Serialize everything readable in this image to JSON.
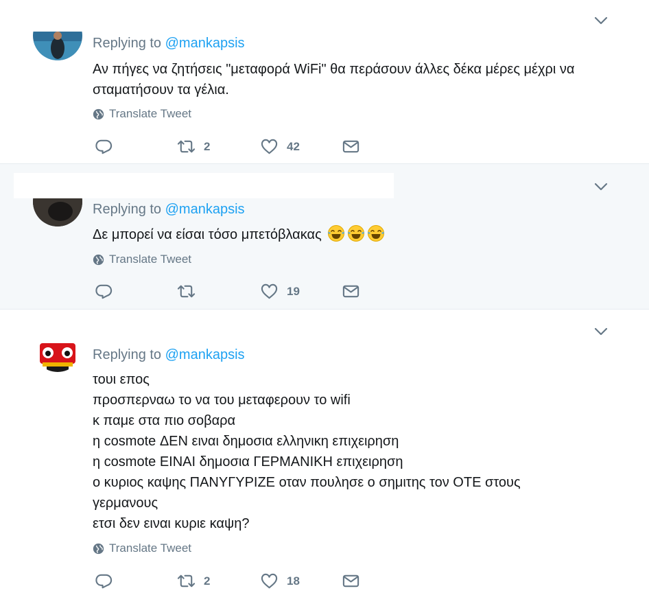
{
  "colors": {
    "accent": "#1da1f2",
    "muted": "#657786",
    "text": "#14171a",
    "highlight_bg": "#f5f8fa"
  },
  "tweets": [
    {
      "replying_prefix": "Replying to",
      "handle": "@mankapsis",
      "lines": [
        "Αν πήγες να ζητήσεις \"μεταφορά WiFi\" θα περάσουν άλλες δέκα μέρες μέχρι να σταματήσουν τα γέλια."
      ],
      "translate_label": "Translate Tweet",
      "retweets": "2",
      "likes": "42"
    },
    {
      "replying_prefix": "Replying to",
      "handle": "@mankapsis",
      "lines": [
        "Δε μπορεί να είσαι τόσο μπετόβλακας"
      ],
      "emojis": [
        "face-with-tears-of-joy",
        "face-with-tears-of-joy",
        "face-with-tears-of-joy"
      ],
      "translate_label": "Translate Tweet",
      "retweets": "",
      "likes": "19"
    },
    {
      "replying_prefix": "Replying to",
      "handle": "@mankapsis",
      "lines": [
        "τουι επος",
        "προσπερναω το να του μεταφερουν το wifi",
        "κ παμε στα πιο σοβαρα",
        "η cosmote ΔΕΝ ειναι δημοσια ελληνικη επιχειρηση",
        "η cosmote ΕΙΝΑΙ δημοσια ΓΕΡΜΑΝΙΚΗ επιχειρηση",
        "ο κυριος καψης ΠΑΝΥΓΥΡΙΖΕ οταν πουλησε ο σημιτης τον ΟΤΕ στους",
        "γερμανους",
        "ετσι δεν ειναι κυριε καψη?"
      ],
      "translate_label": "Translate Tweet",
      "retweets": "2",
      "likes": "18"
    }
  ],
  "icons": {
    "reply": "reply-icon",
    "retweet": "retweet-icon",
    "like": "heart-icon",
    "dm": "envelope-icon",
    "more": "chevron-down-icon",
    "translate": "globe-icon"
  }
}
